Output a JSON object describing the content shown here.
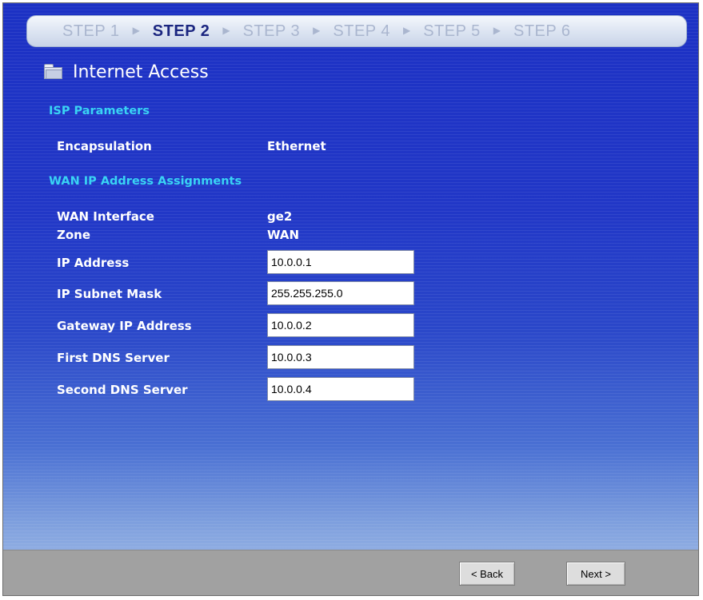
{
  "steps": {
    "items": [
      "STEP 1",
      "STEP 2",
      "STEP 3",
      "STEP 4",
      "STEP 5",
      "STEP 6"
    ],
    "active_index": 1
  },
  "page": {
    "title": "Internet Access",
    "icon": "folder-icon"
  },
  "isp": {
    "section_title": "ISP Parameters",
    "encapsulation_label": "Encapsulation",
    "encapsulation_value": "Ethernet"
  },
  "wan": {
    "section_title": "WAN IP Address Assignments",
    "interface_label": "WAN Interface",
    "interface_value": "ge2",
    "zone_label": "Zone",
    "zone_value": "WAN",
    "fields": [
      {
        "label": "IP Address",
        "value": "10.0.0.1"
      },
      {
        "label": "IP Subnet Mask",
        "value": "255.255.255.0"
      },
      {
        "label": "Gateway IP Address",
        "value": "10.0.0.2"
      },
      {
        "label": "First DNS Server",
        "value": "10.0.0.3"
      },
      {
        "label": "Second DNS Server",
        "value": "10.0.0.4"
      }
    ]
  },
  "buttons": {
    "back_label": "< Back",
    "next_label": "Next >"
  },
  "colors": {
    "background_top": "#1c31c4",
    "section_title": "#39d4f4",
    "active_step": "#1b2680",
    "inactive_step": "#aab6cf",
    "footer": "#a1a1a1"
  }
}
